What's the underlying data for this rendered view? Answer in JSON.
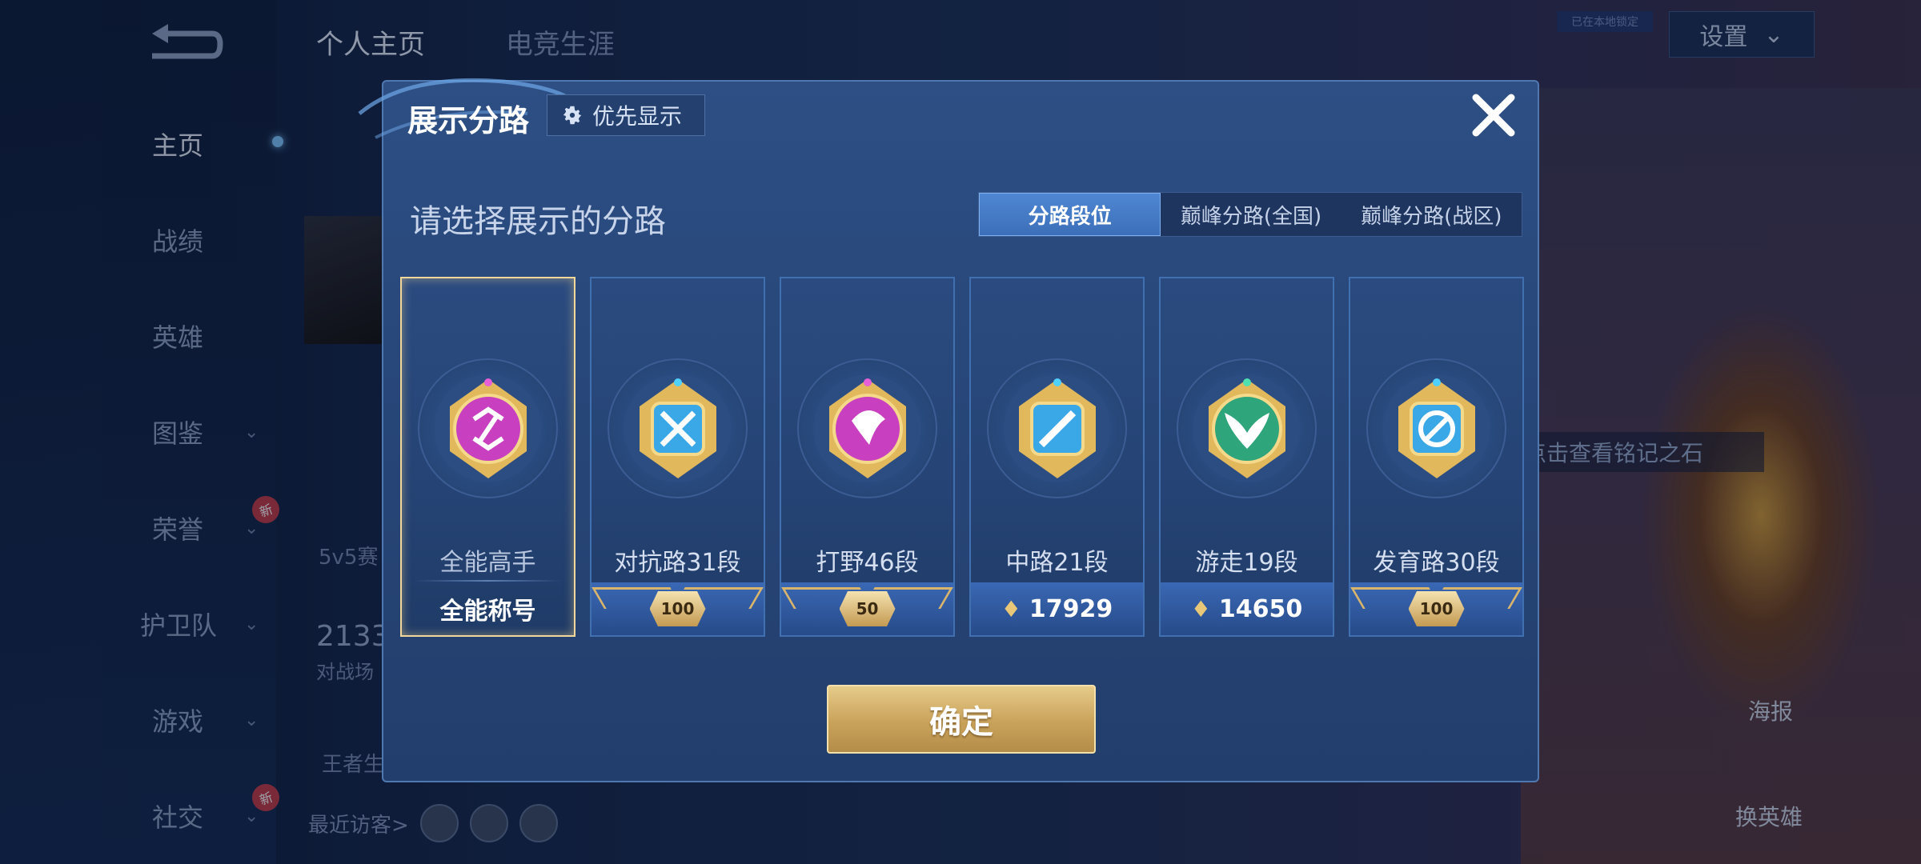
{
  "background": {
    "tabs": [
      "个人主页",
      "电竞生涯"
    ],
    "chip": "已在本地锁定",
    "settings": "设置",
    "side_text_1": "5v5赛",
    "stat_number": "2133",
    "stat_label": "对战场",
    "player_text": "王者生",
    "visitors_label": "最近访客>",
    "inscription": "点击查看铭记之石",
    "poster": "海报",
    "change_hero": "换英雄"
  },
  "nav": {
    "items": [
      {
        "label": "主页"
      },
      {
        "label": "战绩"
      },
      {
        "label": "英雄"
      },
      {
        "label": "图鉴"
      },
      {
        "label": "荣誉",
        "badge": "新"
      },
      {
        "label": "护卫队"
      },
      {
        "label": "游戏"
      },
      {
        "label": "社交",
        "badge": "新"
      }
    ]
  },
  "modal": {
    "title": "展示分路",
    "priority_button": "优先显示",
    "subtitle": "请选择展示的分路",
    "tabs": [
      "分路段位",
      "巅峰分路(全国)",
      "巅峰分路(战区)"
    ],
    "active_tab": "分路段位",
    "cards": [
      {
        "name": "全能高手",
        "footer": "全能称号",
        "selected": true,
        "color": "#c83fbf"
      },
      {
        "name": "对抗路31段",
        "footer": "100",
        "color": "#3aa7e6"
      },
      {
        "name": "打野46段",
        "footer": "50",
        "color": "#c83fbf"
      },
      {
        "name": "中路21段",
        "footer": "17929",
        "color": "#3aa7e6"
      },
      {
        "name": "游走19段",
        "footer": "14650",
        "color": "#2ea57a"
      },
      {
        "name": "发育路30段",
        "footer": "100",
        "color": "#3aa7e6"
      }
    ],
    "confirm": "确定"
  }
}
